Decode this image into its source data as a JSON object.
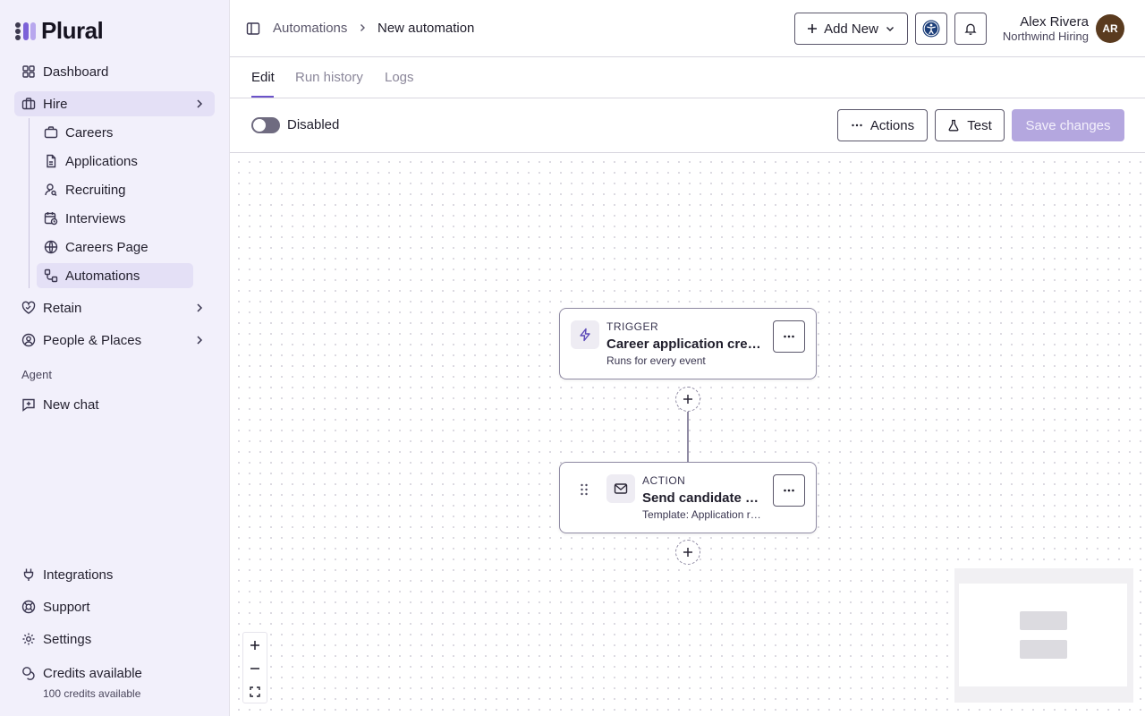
{
  "app": {
    "name": "Plural"
  },
  "sidebar": {
    "items": [
      {
        "label": "Dashboard"
      },
      {
        "label": "Hire"
      },
      {
        "label": "Retain"
      },
      {
        "label": "People & Places"
      }
    ],
    "hire_children": [
      {
        "label": "Careers"
      },
      {
        "label": "Applications"
      },
      {
        "label": "Recruiting"
      },
      {
        "label": "Interviews"
      },
      {
        "label": "Careers Page"
      },
      {
        "label": "Automations"
      }
    ],
    "agent_section": "Agent",
    "new_chat": "New chat",
    "bottom": [
      {
        "label": "Integrations"
      },
      {
        "label": "Support"
      },
      {
        "label": "Settings"
      },
      {
        "label": "Credits available"
      }
    ],
    "credits_sub": "100 credits available"
  },
  "header": {
    "breadcrumb": [
      "Automations",
      "New automation"
    ],
    "add_new": "Add New",
    "user": {
      "name": "Alex Rivera",
      "org": "Northwind Hiring",
      "initials": "AR"
    }
  },
  "tabs": [
    {
      "label": "Edit",
      "active": true
    },
    {
      "label": "Run history",
      "active": false
    },
    {
      "label": "Logs",
      "active": false
    }
  ],
  "toolbar": {
    "status_label": "Disabled",
    "enabled": false,
    "actions": "Actions",
    "test": "Test",
    "save": "Save changes"
  },
  "flow": {
    "trigger": {
      "kind": "TRIGGER",
      "title": "Career application created",
      "subtitle": "Runs for every event",
      "icon": "lightning-icon"
    },
    "action": {
      "kind": "ACTION",
      "title": "Send candidate email",
      "subtitle": "Template: Application received",
      "icon": "mail-icon"
    }
  },
  "colors": {
    "accent": "#6b53c9",
    "save_disabled": "#b4a7df",
    "sidebar_bg": "#f2f0fb"
  }
}
